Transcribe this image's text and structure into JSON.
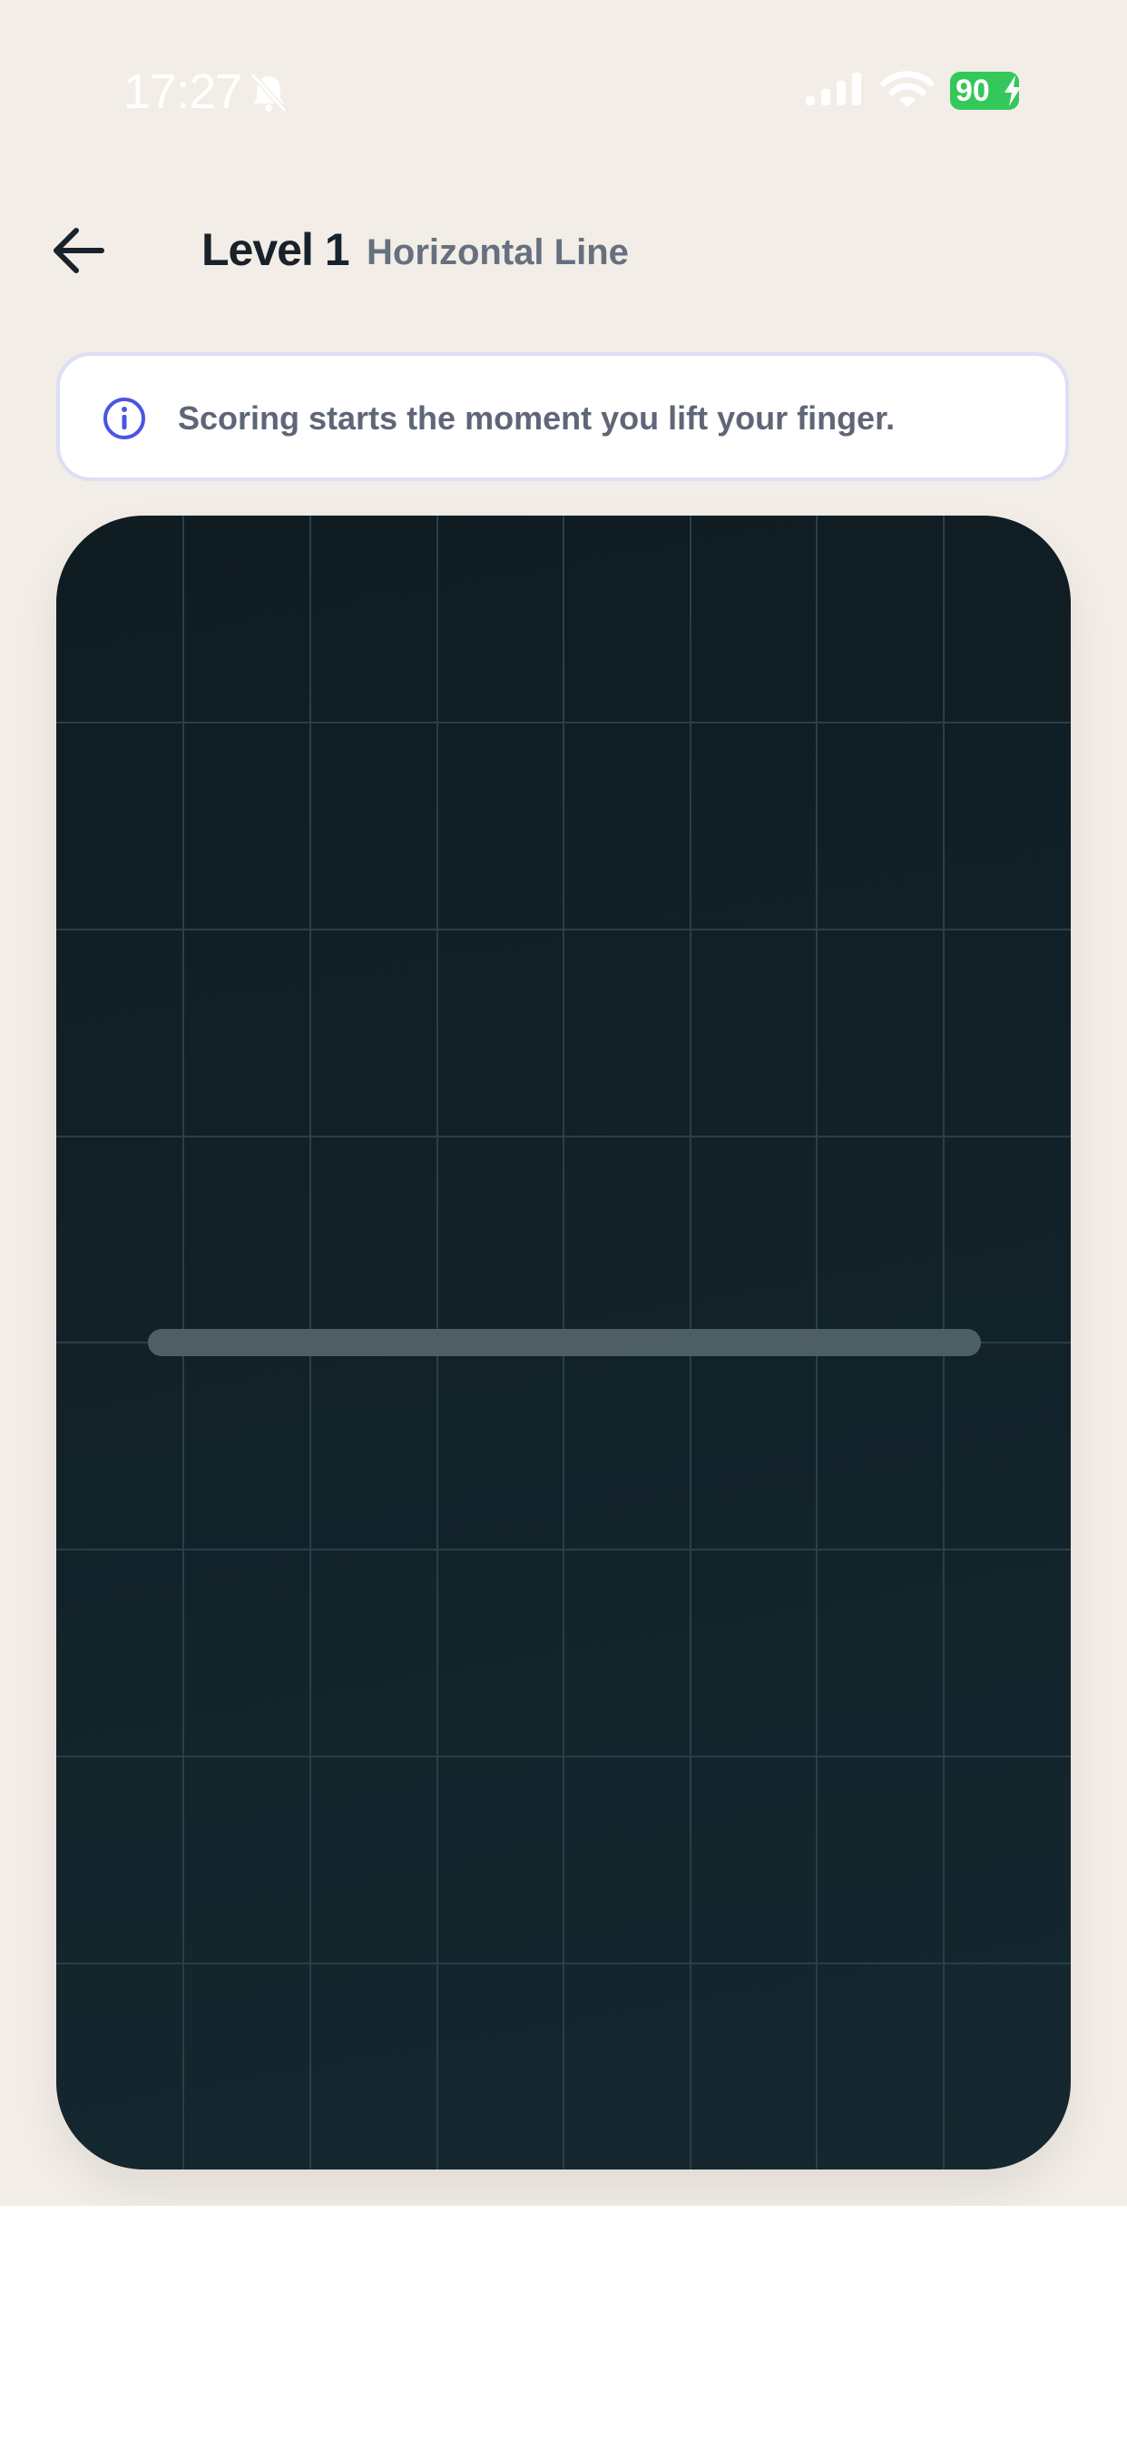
{
  "status_bar": {
    "time": "17:27",
    "battery_level": "90",
    "battery_color": "#34c759"
  },
  "header": {
    "title": "Level 1",
    "subtitle": "Horizontal Line"
  },
  "banner": {
    "text": "Scoring starts the moment you lift your finger.",
    "icon": "info-icon",
    "accent": "#4a56e2"
  },
  "canvas": {
    "background": "#12232b",
    "grid_color": "#2a3f47",
    "guide_line_color": "#4d5f64"
  }
}
